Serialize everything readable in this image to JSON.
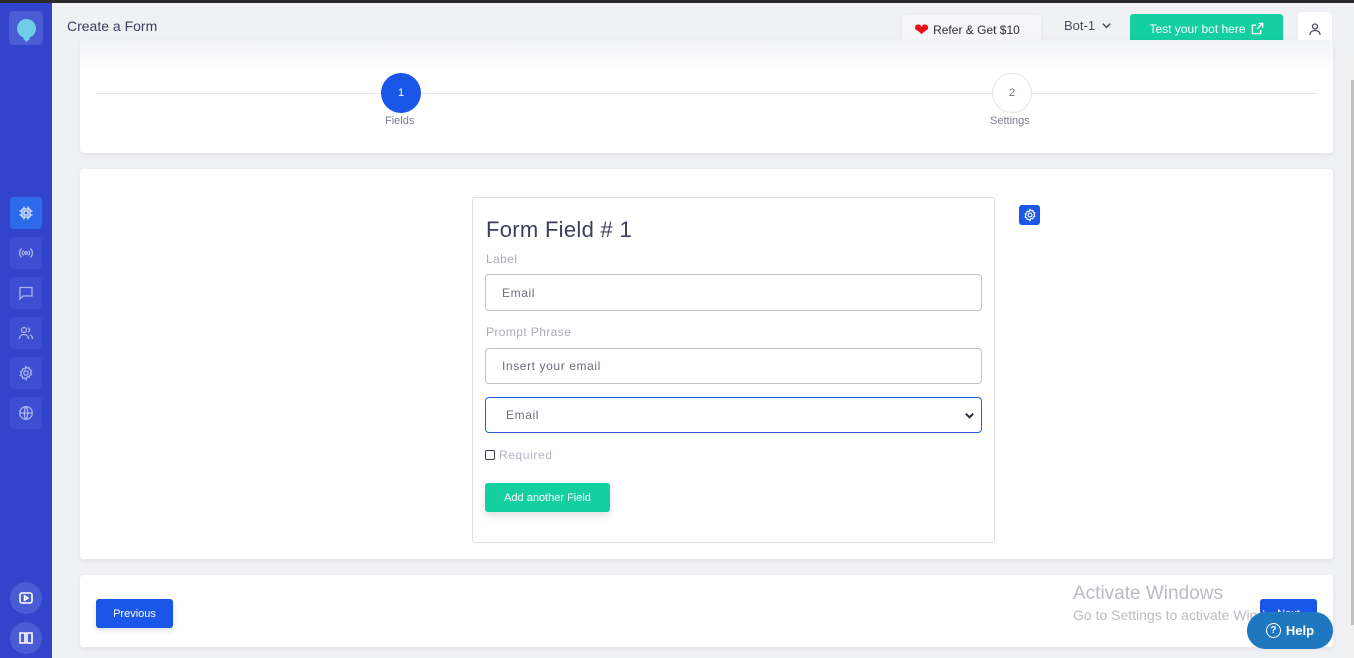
{
  "header": {
    "title": "Create a Form",
    "refer_label": "Refer & Get $10",
    "bot_name": "Bot-1",
    "test_bot_label": "Test your bot here"
  },
  "sidebar": {
    "items": [
      {
        "name": "chip",
        "icon": "cpu-icon",
        "active": true
      },
      {
        "name": "broadcast",
        "icon": "broadcast-icon",
        "active": false
      },
      {
        "name": "chat",
        "icon": "chat-icon",
        "active": false
      },
      {
        "name": "users",
        "icon": "users-icon",
        "active": false
      },
      {
        "name": "settings",
        "icon": "gear-icon",
        "active": false
      },
      {
        "name": "globe",
        "icon": "globe-icon",
        "active": false
      }
    ],
    "bottom_items": [
      {
        "name": "video",
        "icon": "video-play-icon"
      },
      {
        "name": "docs",
        "icon": "book-icon"
      }
    ]
  },
  "stepper": {
    "steps": [
      {
        "number": "1",
        "label": "Fields",
        "active": true
      },
      {
        "number": "2",
        "label": "Settings",
        "active": false
      }
    ]
  },
  "form_field": {
    "title": "Form Field # 1",
    "label_caption": "Label",
    "label_value": "Email",
    "prompt_caption": "Prompt Phrase",
    "prompt_value": "Insert your email",
    "type_selected": "Email",
    "required_label": "Required",
    "required_checked": false,
    "add_field_label": "Add another Field"
  },
  "navigation": {
    "previous_label": "Previous",
    "next_label": "Next"
  },
  "watermark": {
    "title": "Activate Windows",
    "subtitle": "Go to Settings to activate Windows."
  },
  "help": {
    "label": "Help"
  },
  "colors": {
    "sidebar": "#3344cc",
    "primary": "#1a56e8",
    "accent": "#14cfa0",
    "help": "#1f77c0"
  }
}
